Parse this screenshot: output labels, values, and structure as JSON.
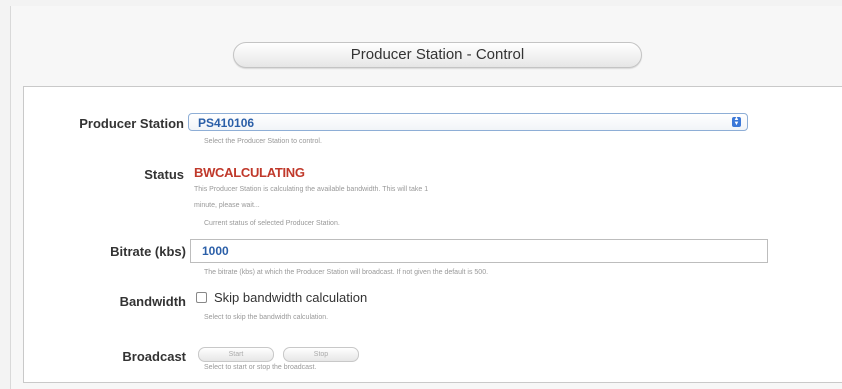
{
  "page": {
    "title": "Producer Station - Control"
  },
  "producer_station": {
    "label": "Producer Station",
    "value": "PS410106",
    "help": "Select the Producer Station to control."
  },
  "status": {
    "label": "Status",
    "value": "BWCALCULATING",
    "note_line1": "This Producer Station is calculating the available bandwidth. This will take 1",
    "note_line2": "minute, please wait...",
    "help": "Current status of selected Producer Station."
  },
  "bitrate": {
    "label": "Bitrate (kbs)",
    "value": "1000",
    "help": "The bitrate (kbs) at which the Producer Station will broadcast. If not given the default is 500."
  },
  "bandwidth": {
    "label": "Bandwidth",
    "checkbox_label": "Skip bandwidth calculation",
    "checked": false,
    "help": "Select to skip the bandwidth calculation."
  },
  "broadcast": {
    "label": "Broadcast",
    "start_label": "Start",
    "stop_label": "Stop",
    "help": "Select to start or stop the broadcast."
  },
  "colors": {
    "status_value": "#c0392b",
    "field_value": "#2b5fa8",
    "select_border": "#8eaed6"
  }
}
